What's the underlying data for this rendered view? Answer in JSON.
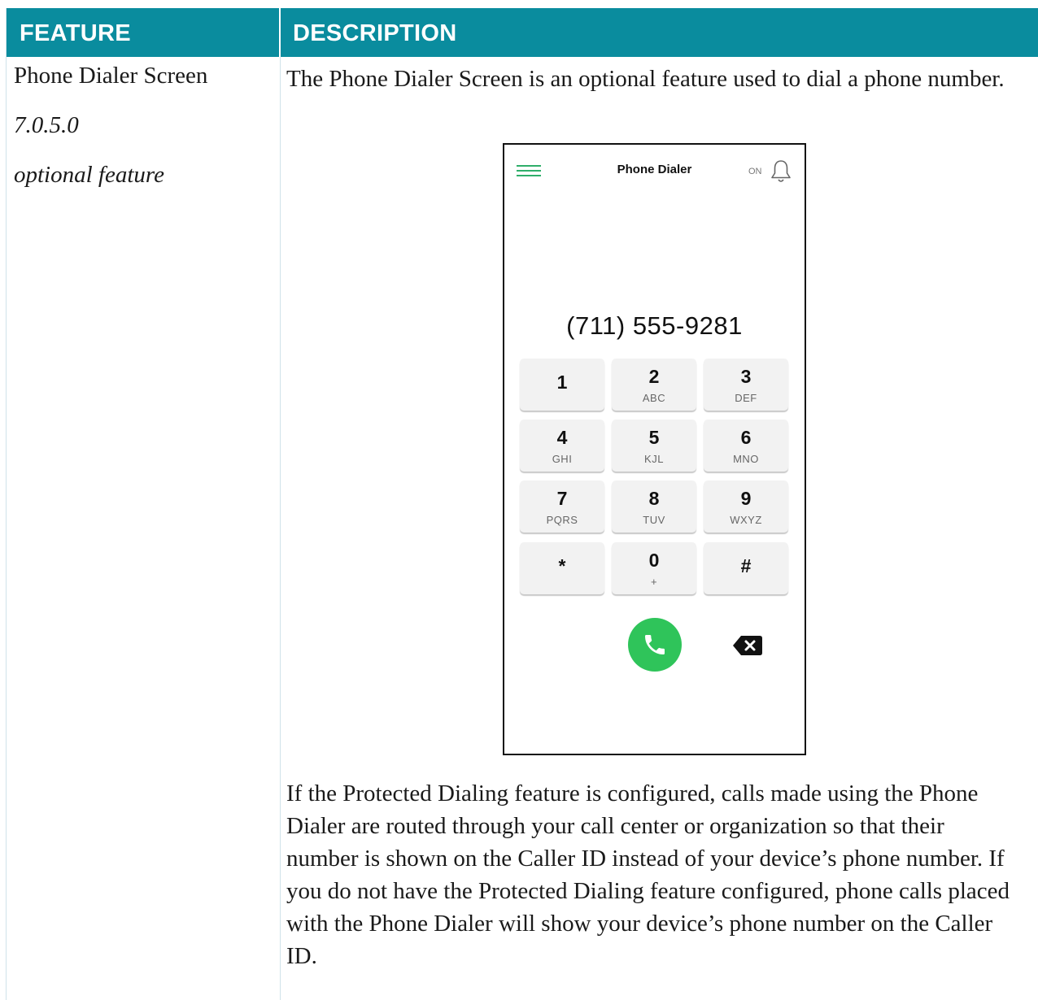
{
  "table": {
    "header_feature": "FEATURE",
    "header_description": "DESCRIPTION"
  },
  "feature": {
    "name": "Phone Dialer Screen",
    "version": "7.0.5.0",
    "note": "optional feature"
  },
  "description": {
    "intro": "The Phone Dialer Screen is an optional feature used to dial a phone number.",
    "details": "If the Protected Dialing feature is configured, calls made using the Phone Dialer are routed through your call center or organization so that their number is shown on the Caller ID instead of your device’s phone number. If you do not have the Protected Dialing feature configured, phone calls placed with the Phone Dialer will show your device’s phone number on the Caller ID."
  },
  "phone": {
    "title": "Phone Dialer",
    "notification_status": "ON",
    "dialed_number": "(711) 555-9281",
    "keys": [
      {
        "digit": "1",
        "letters": ""
      },
      {
        "digit": "2",
        "letters": "ABC"
      },
      {
        "digit": "3",
        "letters": "DEF"
      },
      {
        "digit": "4",
        "letters": "GHI"
      },
      {
        "digit": "5",
        "letters": "KJL"
      },
      {
        "digit": "6",
        "letters": "MNO"
      },
      {
        "digit": "7",
        "letters": "PQRS"
      },
      {
        "digit": "8",
        "letters": "TUV"
      },
      {
        "digit": "9",
        "letters": "WXYZ"
      },
      {
        "digit": "*",
        "letters": ""
      },
      {
        "digit": "0",
        "letters": "+"
      },
      {
        "digit": "#",
        "letters": ""
      }
    ],
    "icons": {
      "menu": "hamburger-menu-icon",
      "bell": "bell-icon",
      "call": "phone-icon",
      "delete": "backspace-icon"
    },
    "colors": {
      "accent_green": "#2fae6a",
      "call_button": "#2fc45a",
      "header_teal": "#0a8c9e",
      "key_background": "#f2f2f2"
    }
  }
}
